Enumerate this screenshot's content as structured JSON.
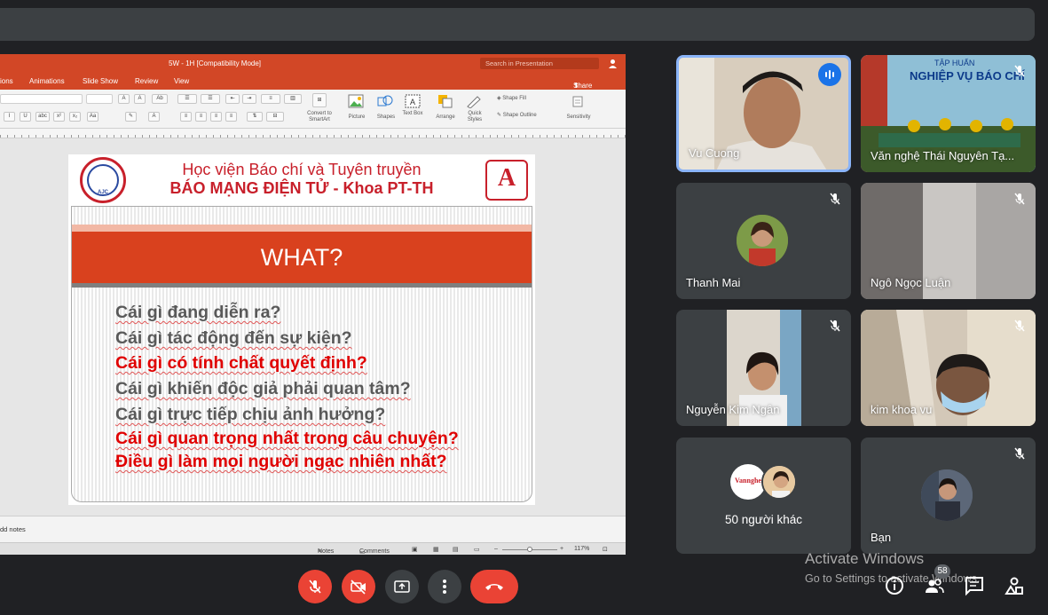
{
  "powerpoint": {
    "doc_title": "5W - 1H [Compatibility Mode]",
    "search_placeholder": "Search in Presentation",
    "tabs": [
      "ions",
      "Animations",
      "Slide Show",
      "Review",
      "View"
    ],
    "share_label": "Share",
    "ribbon": {
      "convert_smartart": "Convert to SmartArt",
      "picture": "Picture",
      "shapes": "Shapes",
      "text_box": "Text Box",
      "arrange": "Arrange",
      "quick_styles": "Quick Styles",
      "shape_fill": "Shape Fill",
      "shape_outline": "Shape Outline",
      "sensitivity": "Sensitivity"
    },
    "notes_placeholder": "dd notes",
    "status": {
      "notes": "Notes",
      "comments": "Comments",
      "zoom": "117%"
    }
  },
  "slide": {
    "left_logo_text": "AJC",
    "right_logo_letter": "A",
    "header_line1": "Học viện Báo chí và Tuyên truyền",
    "header_line2": "BÁO MẠNG ĐIỆN TỬ - Khoa PT-TH",
    "title": "WHAT?",
    "questions": [
      {
        "text": "Cái gì đang diễn ra?",
        "color": "#595959"
      },
      {
        "text": "Cái gì tác động đến sự kiện?",
        "color": "#595959"
      },
      {
        "text": "Cái gì có tính chất quyết định?",
        "color": "#e00000"
      },
      {
        "text": "Cái gì khiến độc giả phải quan tâm?",
        "color": "#595959"
      },
      {
        "text": "Cái gì trực tiếp chịu ảnh hưởng?",
        "color": "#595959"
      },
      {
        "text": "Cái gì quan trọng nhất trong câu chuyện?",
        "color": "#e00000"
      },
      {
        "text": "Điều gì làm mọi người ngạc nhiên nhất?",
        "color": "#e00000"
      }
    ]
  },
  "participants": {
    "vu_cuong": "Vu Cuong",
    "van_nghe": "Văn nghệ Thái Nguyên Tạ...",
    "van_nghe_banner_1": "TẬP HUẤN",
    "van_nghe_banner_2": "NGHIỆP VỤ BÁO CHÍ",
    "thanh_mai": "Thanh Mai",
    "ngo_ngoc_luan": "Ngô Ngọc Luận",
    "nguyen_kim_ngan": "Nguyễn Kim Ngân",
    "kim_khoa_vu": "kim khoa vu",
    "others": "50 người khác",
    "others_avatar_text": "Vannghe",
    "ban": "Bạn"
  },
  "watermark": {
    "line1": "Activate Windows",
    "line2": "Go to Settings to activate Windows."
  },
  "people_count": "58",
  "colors": {
    "accent_red": "#ea4335",
    "tile_bg": "#3c4043",
    "active_border": "#8ab4f8",
    "ppt_orange": "#d24726"
  }
}
